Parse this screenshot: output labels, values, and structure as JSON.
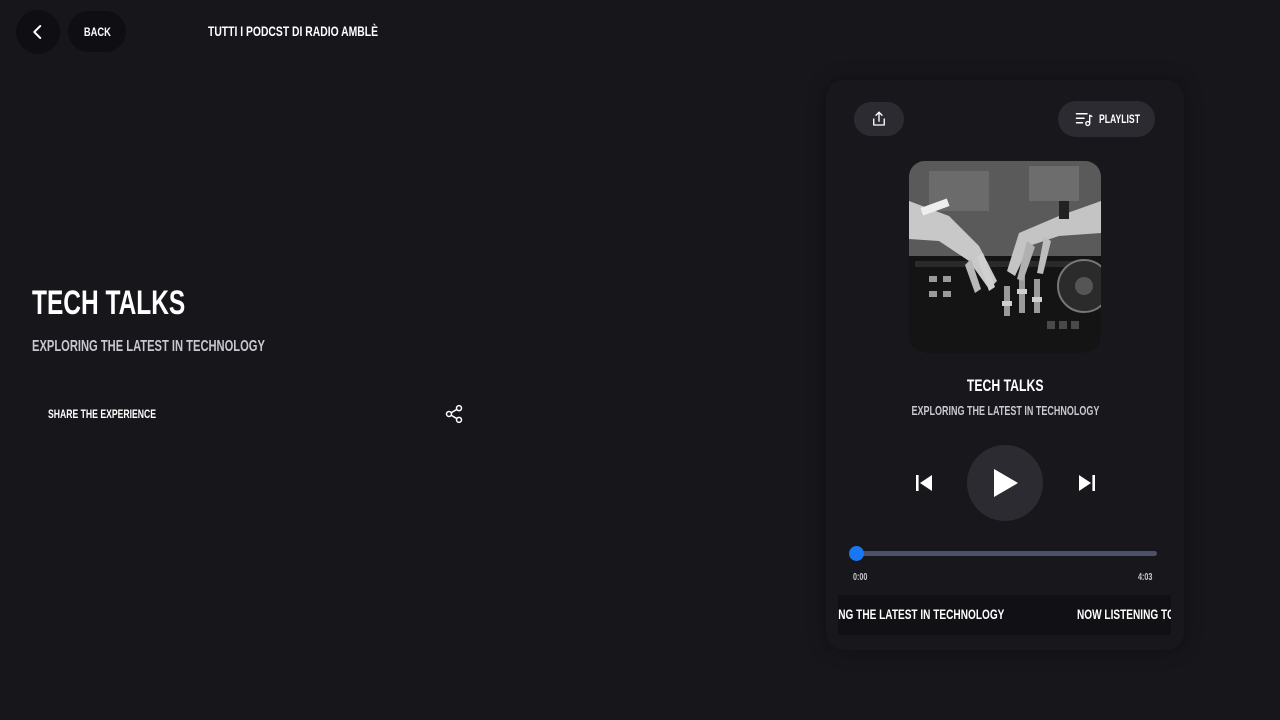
{
  "header": {
    "back_label": "BACK",
    "title": "TUTTI I PODCST DI RADIO AMBLÈ"
  },
  "hero": {
    "title": "TECH TALKS",
    "subtitle": "EXPLORING THE LATEST IN TECHNOLOGY",
    "share_label": "SHARE THE EXPERIENCE"
  },
  "player": {
    "playlist_label": "PLAYLIST",
    "track_title": "TECH TALKS",
    "track_subtitle": "EXPLORING THE LATEST IN TECHNOLOGY",
    "time_current": "0:00",
    "time_total": "4:03",
    "progress": 0.0,
    "ticker_text": "EXPLORING THE LATEST IN TECHNOLOGY",
    "ticker_prefix": "NOW LISTENING TO:"
  },
  "icons": {
    "back": "chevron-left-icon",
    "share": "share-nodes-icon",
    "upload": "upload-icon",
    "playlist": "playlist-icon",
    "prev": "skip-previous-icon",
    "play": "play-icon",
    "next": "skip-next-icon"
  },
  "colors": {
    "background": "#17161b",
    "accent": "#1877f2",
    "track": "#4a5168",
    "button": "#2c2b31"
  }
}
